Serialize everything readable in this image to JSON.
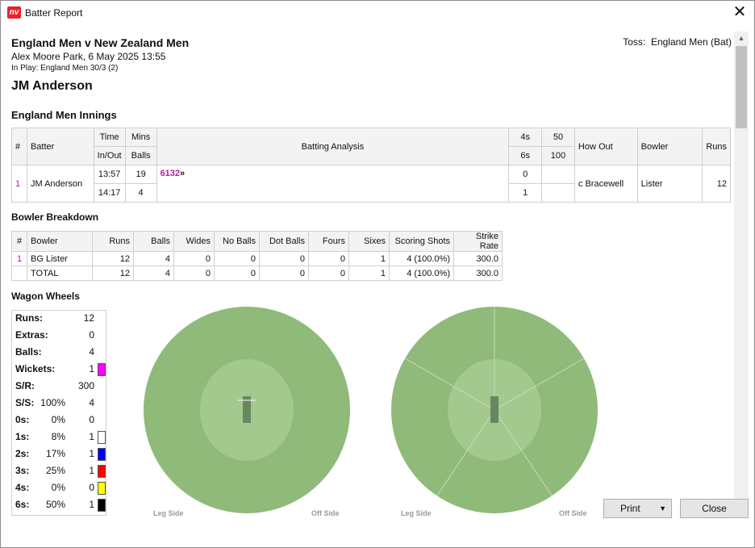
{
  "window": {
    "title": "Batter Report",
    "app_icon_text": "nv"
  },
  "header": {
    "match": "England Men v New Zealand Men",
    "venue": "Alex Moore Park, 6 May 2025 13:55",
    "in_play": "In Play: England Men 30/3 (2)",
    "toss_label": "Toss:",
    "toss_value": "England Men (Bat)",
    "batter": "JM Anderson"
  },
  "innings": {
    "title": "England Men Innings",
    "headers": {
      "num": "#",
      "batter": "Batter",
      "time": "Time",
      "inout": "In/Out",
      "mins": "Mins",
      "balls": "Balls",
      "analysis": "Batting Analysis",
      "fours": "4s",
      "sixes": "6s",
      "fifty": "50",
      "hundred": "100",
      "howout": "How Out",
      "bowler": "Bowler",
      "runs": "Runs"
    },
    "row": {
      "num": "1",
      "batter": "JM Anderson",
      "time_in": "13:57",
      "time_out": "14:17",
      "mins": "19",
      "balls": "4",
      "analysis": "6132",
      "analysis_arrow": "»",
      "fours": "0",
      "sixes": "1",
      "fifty": "",
      "hundred": "",
      "howout": "c Bracewell",
      "bowler": "Lister",
      "runs": "12"
    }
  },
  "bowler_breakdown": {
    "title": "Bowler Breakdown",
    "headers": [
      "#",
      "Bowler",
      "Runs",
      "Balls",
      "Wides",
      "No Balls",
      "Dot Balls",
      "Fours",
      "Sixes",
      "Scoring Shots",
      "Strike Rate"
    ],
    "rows": [
      [
        "1",
        "BG Lister",
        "12",
        "4",
        "0",
        "0",
        "0",
        "0",
        "1",
        "4 (100.0%)",
        "300.0"
      ],
      [
        "",
        "TOTAL",
        "12",
        "4",
        "0",
        "0",
        "0",
        "0",
        "1",
        "4 (100.0%)",
        "300.0"
      ]
    ]
  },
  "wagon": {
    "title": "Wagon Wheels",
    "stats": [
      {
        "label": "Runs:",
        "pct": "",
        "value": "12",
        "color": ""
      },
      {
        "label": "Extras:",
        "pct": "",
        "value": "0",
        "color": ""
      },
      {
        "label": "Balls:",
        "pct": "",
        "value": "4",
        "color": ""
      },
      {
        "label": "Wickets:",
        "pct": "",
        "value": "1",
        "color": "#ff00ff"
      },
      {
        "label": "S/R:",
        "pct": "",
        "value": "300",
        "color": ""
      },
      {
        "label": "S/S:",
        "pct": "100%",
        "value": "4",
        "color": ""
      },
      {
        "label": "0s:",
        "pct": "0%",
        "value": "0",
        "color": ""
      },
      {
        "label": "1s:",
        "pct": "8%",
        "value": "1",
        "color": "#ffffff"
      },
      {
        "label": "2s:",
        "pct": "17%",
        "value": "1",
        "color": "#0000ff"
      },
      {
        "label": "3s:",
        "pct": "25%",
        "value": "1",
        "color": "#ff0000"
      },
      {
        "label": "4s:",
        "pct": "0%",
        "value": "0",
        "color": "#ffff00"
      },
      {
        "label": "6s:",
        "pct": "50%",
        "value": "1",
        "color": "#000000"
      }
    ],
    "leg_side": "Leg Side",
    "off_side": "Off Side",
    "field_color": "#8fba79",
    "infield_color": "#a4c98f"
  },
  "buttons": {
    "print": "Print",
    "close": "Close"
  }
}
